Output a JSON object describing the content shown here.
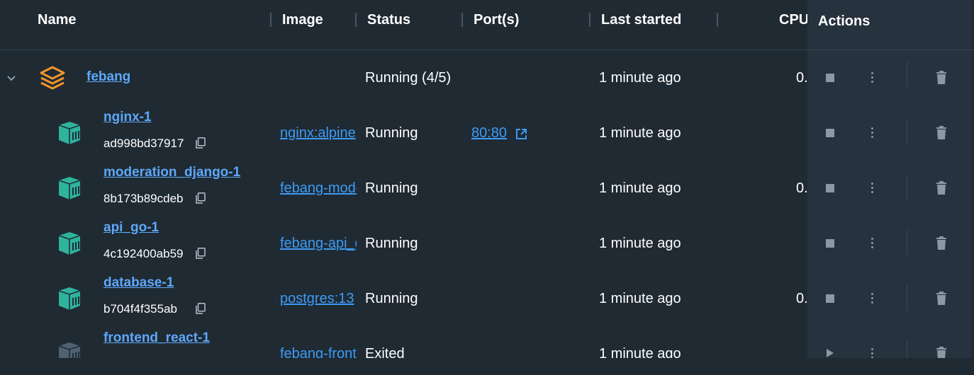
{
  "header": {
    "name": "Name",
    "image": "Image",
    "status": "Status",
    "ports": "Port(s)",
    "last_started": "Last started",
    "cpu": "CPU",
    "actions": "Actions"
  },
  "group": {
    "name": "febang",
    "status": "Running (4/5)",
    "last_started": "1 minute ago",
    "cpu": "0.",
    "icon": "stack-icon",
    "icon_color": "#f0952a"
  },
  "containers": [
    {
      "name": "nginx-1",
      "id": "ad998bd37917",
      "image": "nginx:alpine",
      "status": "Running",
      "port": "80:80",
      "last_started": "1 minute ago",
      "cpu": "",
      "running": true
    },
    {
      "name": "moderation_django-1",
      "id": "8b173b89cdeb",
      "image": "febang-moderation_django",
      "status": "Running",
      "port": "",
      "last_started": "1 minute ago",
      "cpu": "0.",
      "running": true
    },
    {
      "name": "api_go-1",
      "id": "4c192400ab59",
      "image": "febang-api_go",
      "status": "Running",
      "port": "",
      "last_started": "1 minute ago",
      "cpu": "",
      "running": true
    },
    {
      "name": "database-1",
      "id": "b704f4f355ab",
      "image": "postgres:13",
      "status": "Running",
      "port": "",
      "last_started": "1 minute ago",
      "cpu": "0.",
      "running": true
    },
    {
      "name": "frontend_react-1",
      "id": "",
      "image": "febang-frontend_react",
      "status": "Exited",
      "port": "",
      "last_started": "1 minute ago",
      "cpu": "",
      "running": false
    }
  ],
  "colors": {
    "running_container": "#2fb39d",
    "exited_container": "#4f6172",
    "link": "#3d9bf5",
    "background": "#1f2a33"
  }
}
